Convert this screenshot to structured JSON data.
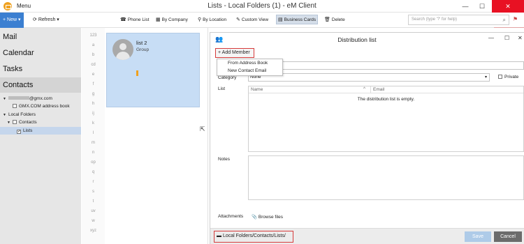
{
  "app": {
    "menu_label": "Menu",
    "window_title": "Lists - Local Folders (1) - eM Client",
    "window_controls": [
      "minimize-icon",
      "maximize-icon",
      "close-icon"
    ]
  },
  "toolbar": {
    "new_label": "New",
    "refresh_label": "Refresh",
    "items": [
      {
        "label": "Phone List",
        "icon": "phone-icon"
      },
      {
        "label": "By Company",
        "icon": "company-icon"
      },
      {
        "label": "By Location",
        "icon": "location-icon"
      },
      {
        "label": "Custom View",
        "icon": "custom-view-icon"
      },
      {
        "label": "Business Cards",
        "icon": "business-card-icon",
        "active": true
      },
      {
        "label": "Delete",
        "icon": "trash-icon"
      }
    ],
    "search_placeholder": "Search (type '?' for help)"
  },
  "sidebar": {
    "nav": [
      "Mail",
      "Calendar",
      "Tasks",
      "Contacts"
    ],
    "selected_nav": "Contacts",
    "tree": [
      {
        "label": "@gmx.com",
        "level": 0
      },
      {
        "label": "GMX.COM address book",
        "level": 1
      },
      {
        "label": "Local Folders",
        "level": 0
      },
      {
        "label": "Contacts",
        "level": 1
      },
      {
        "label": "Lists",
        "level": 2,
        "selected": true
      }
    ]
  },
  "alphabet": [
    "123",
    "a",
    "b",
    "cd",
    "e",
    "f",
    "g",
    "h",
    "ij",
    "k",
    "l",
    "m",
    "n",
    "op",
    "q",
    "r",
    "s",
    "t",
    "uv",
    "w",
    "xyz"
  ],
  "contacts": [
    {
      "name": "list 2",
      "type": "Group"
    }
  ],
  "dialog": {
    "title": "Distribution list",
    "add_member_label": "Add Member",
    "add_member_menu": [
      "From Address Book",
      "New Contact Email"
    ],
    "category_label": "Category",
    "category_value": "None",
    "private_label": "Private",
    "list_label": "List",
    "columns": [
      "Name",
      "Email"
    ],
    "empty_text": "The distribution list is empty.",
    "notes_label": "Notes",
    "attachments_label": "Attachments",
    "browse_label": "Browse files",
    "folder_path": "Local Folders/Contacts/Lists/",
    "save_label": "Save",
    "cancel_label": "Cancel"
  }
}
